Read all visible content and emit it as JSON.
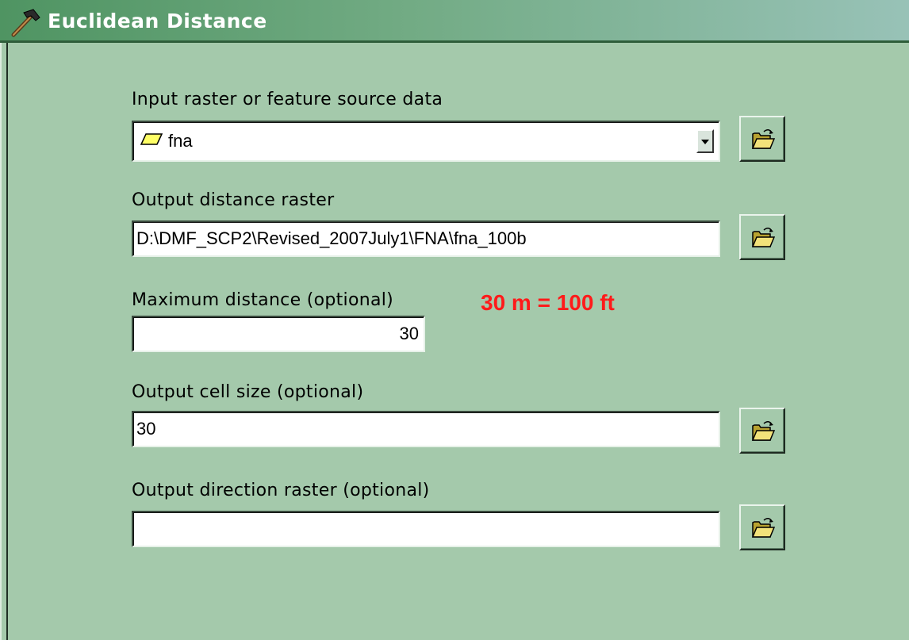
{
  "window": {
    "title": "Euclidean Distance",
    "title_icon": "hammer-icon",
    "colors": {
      "titlebar": "#5a9c6c",
      "background": "#a4c9ab",
      "note": "#ff1a1a"
    }
  },
  "fields": {
    "input_raster": {
      "label": "Input raster or feature source data",
      "value": "fna",
      "value_icon": "polygon-layer-icon",
      "dropdown_icon": "dropdown-arrow-icon",
      "browse_icon": "open-folder-icon"
    },
    "output_distance": {
      "label": "Output distance raster",
      "value": "D:\\DMF_SCP2\\Revised_2007July1\\FNA\\fna_100b",
      "browse_icon": "open-folder-icon"
    },
    "max_distance": {
      "label": "Maximum distance (optional)",
      "value": "30",
      "note": "30 m = 100 ft"
    },
    "cell_size": {
      "label": "Output cell size (optional)",
      "value": "30",
      "browse_icon": "open-folder-icon"
    },
    "output_direction": {
      "label": "Output direction raster (optional)",
      "value": "",
      "browse_icon": "open-folder-icon"
    }
  }
}
